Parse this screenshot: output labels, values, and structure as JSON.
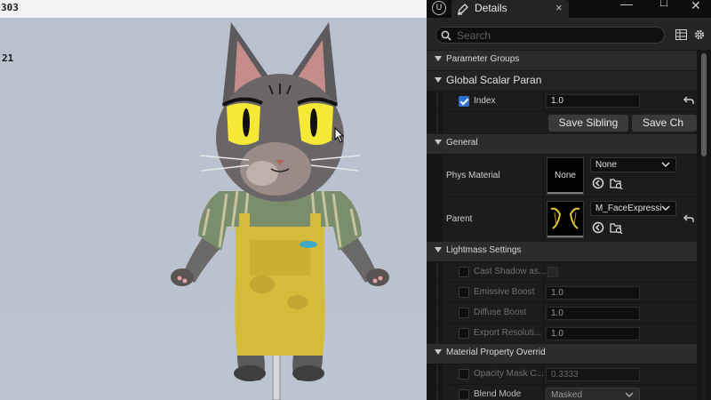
{
  "viewport": {
    "stats": [
      "303",
      "21"
    ]
  },
  "panel": {
    "tab_title": "Details",
    "tab_close": "×",
    "window": {
      "minimize": "—",
      "maximize": "☐",
      "close": "✕"
    },
    "search_placeholder": "Search",
    "sections": {
      "parameter_groups": "Parameter Groups",
      "global_scalar": "Global Scalar Paran",
      "general": "General",
      "lightmass": "Lightmass Settings",
      "mpo": "Material Property Overrid"
    },
    "index": {
      "label": "Index",
      "value": "1.0",
      "checked": true
    },
    "buttons": {
      "save_sibling": "Save Sibling",
      "save_child": "Save Ch"
    },
    "phys_material": {
      "label": "Phys Material",
      "thumb_label": "None",
      "combo_value": "None"
    },
    "parent": {
      "label": "Parent",
      "combo_value": "M_FaceExpressio"
    },
    "lightmass": [
      {
        "label": "Cast Shadow as..."
      },
      {
        "label": "Emissive Boost",
        "value": "1.0"
      },
      {
        "label": "Diffuse Boost",
        "value": "1.0"
      },
      {
        "label": "Export Resoluti...",
        "value": "1.0"
      }
    ],
    "mpo": [
      {
        "label": "Opacity Mask C...",
        "value": "0.3333"
      },
      {
        "label": "Blend Mode",
        "value": "Masked"
      }
    ],
    "colors": {
      "accent": "#2e6fd0",
      "panel_bg": "#151515",
      "section_bg": "#2c2c2c"
    }
  }
}
